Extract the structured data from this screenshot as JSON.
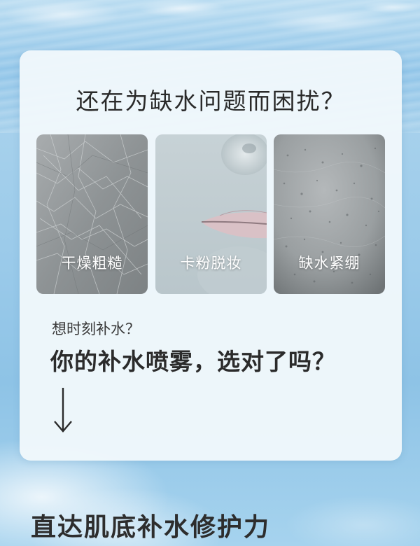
{
  "card": {
    "title": "还在为缺水问题而困扰？",
    "tiles": [
      {
        "label": "干燥粗糙",
        "image": "dry-skin-texture"
      },
      {
        "label": "卡粉脱妆",
        "image": "lips-chin-closeup"
      },
      {
        "label": "缺水紧绷",
        "image": "tight-skin-texture"
      }
    ],
    "question_small": "想时刻补水？",
    "question_big": "你的补水喷雾，选对了吗？",
    "arrow_icon": "arrow-down-icon"
  },
  "bottom": {
    "heading": "直达肌底补水修护力"
  },
  "colors": {
    "card_background": "#f0f8fb",
    "background_blue": "#9ccbea",
    "text_dark": "#2b2b2b"
  }
}
